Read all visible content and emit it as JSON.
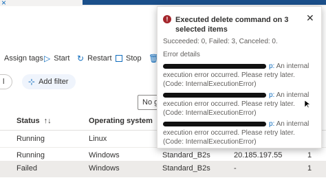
{
  "toolbar": {
    "assign_tags": "Assign tags",
    "start": "Start",
    "restart": "Restart",
    "stop": "Stop"
  },
  "filter": {
    "add_filter": "Add filter",
    "chip_text": "l"
  },
  "grouping": {
    "value": "No gr"
  },
  "table": {
    "headers": {
      "status": "Status",
      "os": "Operating system"
    },
    "rows": [
      {
        "status": "Running",
        "os": "Linux",
        "size": "",
        "ip": "",
        "count": ""
      },
      {
        "status": "Running",
        "os": "Windows",
        "size": "Standard_B2s",
        "ip": "20.185.197.55",
        "count": "1"
      },
      {
        "status": "Failed",
        "os": "Windows",
        "size": "Standard_B2s",
        "ip": "-",
        "count": "1"
      }
    ]
  },
  "notification": {
    "title": "Executed delete command on 3 selected items",
    "summary": "Succeeded: 0, Failed: 3, Canceled: 0.",
    "error_label": "Error details",
    "errors": [
      {
        "link_suffix": "p:",
        "message": "An internal execution error occurred. Please retry later. (Code: InternalExecutionError)"
      },
      {
        "link_suffix": "p:",
        "message": "An internal execution error occurred. Please retry later. (Code: InternalExecutionError)"
      },
      {
        "link_suffix": "p:",
        "message": "An internal execution error occurred. Please retry later. (Code: InternalExecutionError)"
      }
    ]
  },
  "colors": {
    "accent": "#0f6cbd",
    "error": "#a4262c",
    "selected_row": "#edebe9"
  }
}
